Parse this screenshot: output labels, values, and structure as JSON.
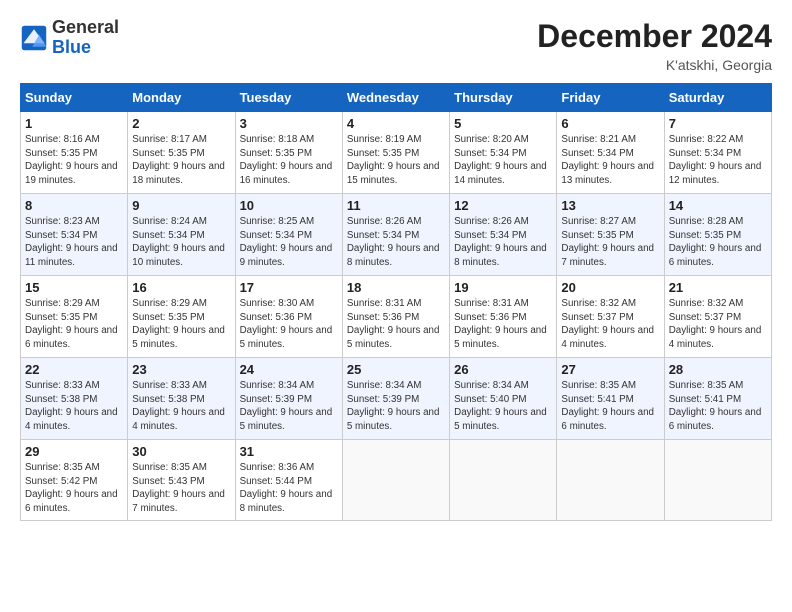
{
  "header": {
    "logo_line1": "General",
    "logo_line2": "Blue",
    "month": "December 2024",
    "location": "K'atskhi, Georgia"
  },
  "weekdays": [
    "Sunday",
    "Monday",
    "Tuesday",
    "Wednesday",
    "Thursday",
    "Friday",
    "Saturday"
  ],
  "weeks": [
    [
      {
        "day": "1",
        "sunrise": "8:16 AM",
        "sunset": "5:35 PM",
        "daylight": "9 hours and 19 minutes."
      },
      {
        "day": "2",
        "sunrise": "8:17 AM",
        "sunset": "5:35 PM",
        "daylight": "9 hours and 18 minutes."
      },
      {
        "day": "3",
        "sunrise": "8:18 AM",
        "sunset": "5:35 PM",
        "daylight": "9 hours and 16 minutes."
      },
      {
        "day": "4",
        "sunrise": "8:19 AM",
        "sunset": "5:35 PM",
        "daylight": "9 hours and 15 minutes."
      },
      {
        "day": "5",
        "sunrise": "8:20 AM",
        "sunset": "5:34 PM",
        "daylight": "9 hours and 14 minutes."
      },
      {
        "day": "6",
        "sunrise": "8:21 AM",
        "sunset": "5:34 PM",
        "daylight": "9 hours and 13 minutes."
      },
      {
        "day": "7",
        "sunrise": "8:22 AM",
        "sunset": "5:34 PM",
        "daylight": "9 hours and 12 minutes."
      }
    ],
    [
      {
        "day": "8",
        "sunrise": "8:23 AM",
        "sunset": "5:34 PM",
        "daylight": "9 hours and 11 minutes."
      },
      {
        "day": "9",
        "sunrise": "8:24 AM",
        "sunset": "5:34 PM",
        "daylight": "9 hours and 10 minutes."
      },
      {
        "day": "10",
        "sunrise": "8:25 AM",
        "sunset": "5:34 PM",
        "daylight": "9 hours and 9 minutes."
      },
      {
        "day": "11",
        "sunrise": "8:26 AM",
        "sunset": "5:34 PM",
        "daylight": "9 hours and 8 minutes."
      },
      {
        "day": "12",
        "sunrise": "8:26 AM",
        "sunset": "5:34 PM",
        "daylight": "9 hours and 8 minutes."
      },
      {
        "day": "13",
        "sunrise": "8:27 AM",
        "sunset": "5:35 PM",
        "daylight": "9 hours and 7 minutes."
      },
      {
        "day": "14",
        "sunrise": "8:28 AM",
        "sunset": "5:35 PM",
        "daylight": "9 hours and 6 minutes."
      }
    ],
    [
      {
        "day": "15",
        "sunrise": "8:29 AM",
        "sunset": "5:35 PM",
        "daylight": "9 hours and 6 minutes."
      },
      {
        "day": "16",
        "sunrise": "8:29 AM",
        "sunset": "5:35 PM",
        "daylight": "9 hours and 5 minutes."
      },
      {
        "day": "17",
        "sunrise": "8:30 AM",
        "sunset": "5:36 PM",
        "daylight": "9 hours and 5 minutes."
      },
      {
        "day": "18",
        "sunrise": "8:31 AM",
        "sunset": "5:36 PM",
        "daylight": "9 hours and 5 minutes."
      },
      {
        "day": "19",
        "sunrise": "8:31 AM",
        "sunset": "5:36 PM",
        "daylight": "9 hours and 5 minutes."
      },
      {
        "day": "20",
        "sunrise": "8:32 AM",
        "sunset": "5:37 PM",
        "daylight": "9 hours and 4 minutes."
      },
      {
        "day": "21",
        "sunrise": "8:32 AM",
        "sunset": "5:37 PM",
        "daylight": "9 hours and 4 minutes."
      }
    ],
    [
      {
        "day": "22",
        "sunrise": "8:33 AM",
        "sunset": "5:38 PM",
        "daylight": "9 hours and 4 minutes."
      },
      {
        "day": "23",
        "sunrise": "8:33 AM",
        "sunset": "5:38 PM",
        "daylight": "9 hours and 4 minutes."
      },
      {
        "day": "24",
        "sunrise": "8:34 AM",
        "sunset": "5:39 PM",
        "daylight": "9 hours and 5 minutes."
      },
      {
        "day": "25",
        "sunrise": "8:34 AM",
        "sunset": "5:39 PM",
        "daylight": "9 hours and 5 minutes."
      },
      {
        "day": "26",
        "sunrise": "8:34 AM",
        "sunset": "5:40 PM",
        "daylight": "9 hours and 5 minutes."
      },
      {
        "day": "27",
        "sunrise": "8:35 AM",
        "sunset": "5:41 PM",
        "daylight": "9 hours and 6 minutes."
      },
      {
        "day": "28",
        "sunrise": "8:35 AM",
        "sunset": "5:41 PM",
        "daylight": "9 hours and 6 minutes."
      }
    ],
    [
      {
        "day": "29",
        "sunrise": "8:35 AM",
        "sunset": "5:42 PM",
        "daylight": "9 hours and 6 minutes."
      },
      {
        "day": "30",
        "sunrise": "8:35 AM",
        "sunset": "5:43 PM",
        "daylight": "9 hours and 7 minutes."
      },
      {
        "day": "31",
        "sunrise": "8:36 AM",
        "sunset": "5:44 PM",
        "daylight": "9 hours and 8 minutes."
      },
      null,
      null,
      null,
      null
    ]
  ]
}
